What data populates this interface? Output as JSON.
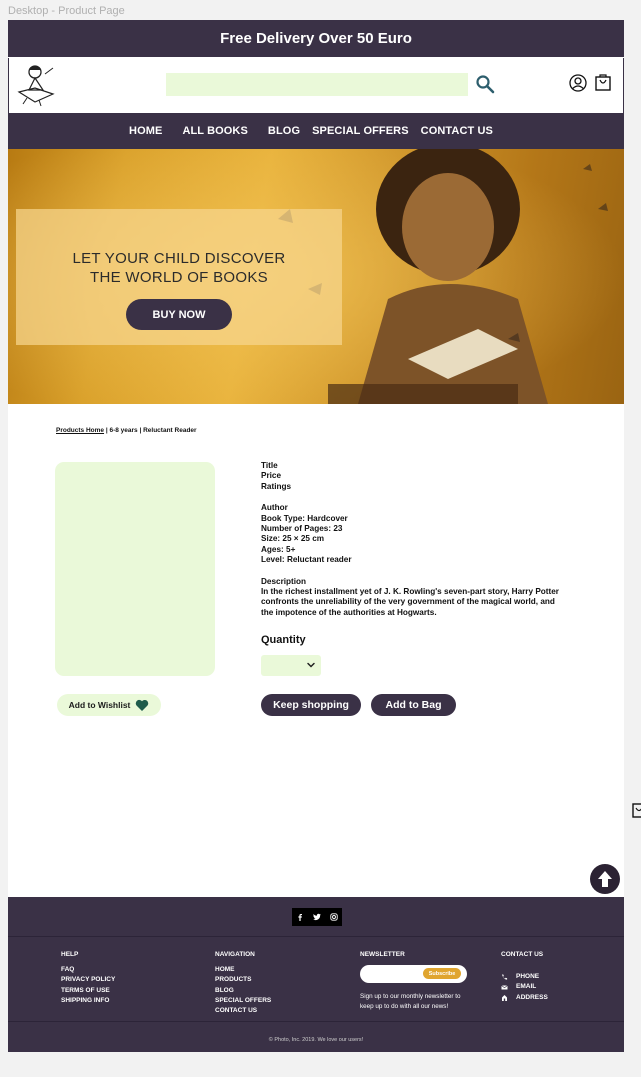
{
  "frame_label": "Desktop - Product Page",
  "promo": {
    "text": "Free Delivery Over 50 Euro"
  },
  "search": {
    "placeholder": ""
  },
  "nav": [
    "HOME",
    "ALL BOOKS",
    "BLOG",
    "SPECIAL OFFERS",
    "CONTACT US"
  ],
  "hero": {
    "title_line1": "LET YOUR CHILD DISCOVER",
    "title_line2": "THE WORLD OF BOOKS",
    "button": "BUY NOW"
  },
  "breadcrumb": {
    "home": "Products Home",
    "rest": " | 6-8 years | Reluctant Reader"
  },
  "product": {
    "title": "Title",
    "price": "Price",
    "ratings": "Ratings",
    "author": "Author",
    "book_type": "Book Type: Hardcover",
    "pages": "Number of Pages: 23",
    "size": "Size: 25 × 25 cm",
    "ages": "Ages: 5+",
    "level": "Level: Reluctant reader",
    "description_label": "Description",
    "description": "In the richest installment yet of J. K. Rowling's seven-part story, Harry Potter confronts the unreliability of the very government of the magical world, and the impotence of the authorities at Hogwarts."
  },
  "quantity": {
    "label": "Quantity"
  },
  "buttons": {
    "wishlist": "Add to Wishlist",
    "keep_shopping": "Keep shopping",
    "add_to_bag": "Add to Bag"
  },
  "footer": {
    "help": {
      "title": "HELP",
      "items": [
        "FAQ",
        "PRIVACY POLICY",
        "TERMS OF USE",
        "SHIPPING INFO"
      ]
    },
    "navigation": {
      "title": "NAVIGATION",
      "items": [
        "HOME",
        "PRODUCTS",
        "BLOG",
        "SPECIAL OFFERS",
        "CONTACT US"
      ]
    },
    "newsletter": {
      "title": "NEWSLETTER",
      "button": "Subscribe",
      "text": "Sign up to our monthly newsletter to keep up to do with all our news!"
    },
    "contact": {
      "title": "CONTACT US",
      "items": [
        "PHONE",
        "EMAIL",
        "ADDRESS"
      ]
    },
    "copyright": "© Photo, Inc. 2019. We love our users!"
  },
  "colors": {
    "brand_dark": "#3a3146",
    "light_green": "#eaf9d9",
    "gold": "#e0a52f",
    "heart": "#1f5c4b"
  }
}
